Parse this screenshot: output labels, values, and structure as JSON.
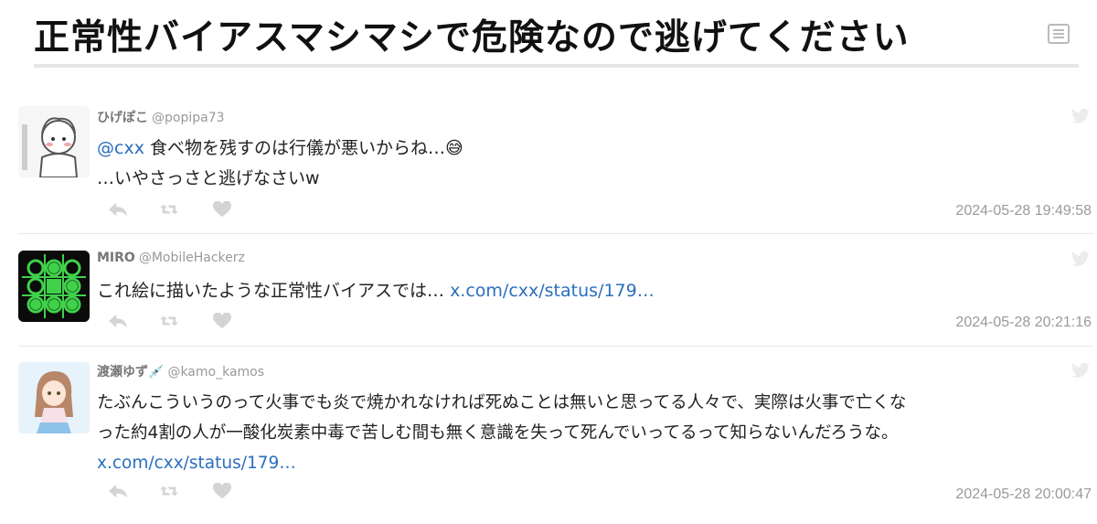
{
  "page": {
    "title": "正常性バイアスマシマシで危険なので逃げてください"
  },
  "tweets": [
    {
      "name": "ひげぽこ",
      "handle": "@popipa73",
      "mention": "@cxx",
      "line1": " 食べ物を残すのは行儀が悪いからね…😅",
      "line2": "…いやさっさと逃げなさいw",
      "timestamp": "2024-05-28 19:49:58"
    },
    {
      "name": "MIRO",
      "handle": "@MobileHackerz",
      "text": "これ絵に描いたような正常性バイアスでは…",
      "link": "x.com/cxx/status/179…",
      "timestamp": "2024-05-28 20:21:16"
    },
    {
      "name": "渡瀬ゆず💉",
      "handle": "@kamo_kamos",
      "line1": "たぶんこういうのって火事でも炎で焼かれなければ死ぬことは無いと思ってる人々で、実際は火事で亡くな",
      "line2": "った約4割の人が一酸化炭素中毒で苦しむ間も無く意識を失って死んでいってるって知らないんだろうな。",
      "link": "x.com/cxx/status/179…",
      "timestamp": "2024-05-28 20:00:47"
    }
  ],
  "colors": {
    "link": "#2a6fbf",
    "muted": "#9a9a9a",
    "icon": "#d0d0d0"
  }
}
